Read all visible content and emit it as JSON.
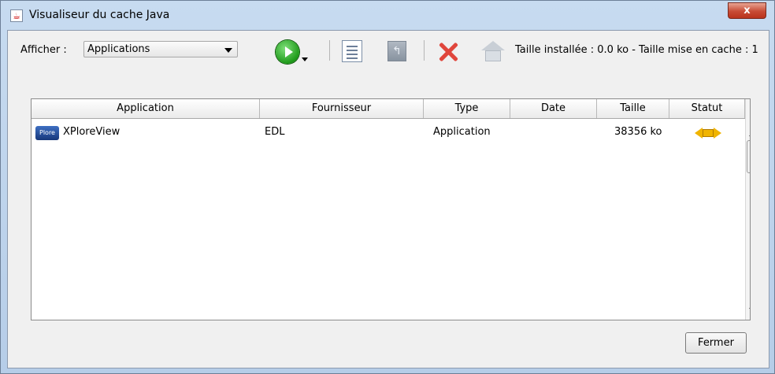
{
  "window": {
    "title": "Visualiseur du cache Java",
    "close_glyph": "x"
  },
  "toolbar": {
    "show_label": "Afficher :",
    "show_value": "Applications",
    "size_info": "Taille installée : 0.0 ko - Taille mise en cache : 1"
  },
  "table": {
    "columns": [
      "Application",
      "Fournisseur",
      "Type",
      "Date",
      "Taille",
      "Statut"
    ],
    "rows": [
      {
        "icon_text": "Plore",
        "application": "XPloreView",
        "vendor": "EDL",
        "type": "Application",
        "date": "",
        "size": "38356 ko"
      }
    ]
  },
  "footer": {
    "close_label": "Fermer"
  }
}
